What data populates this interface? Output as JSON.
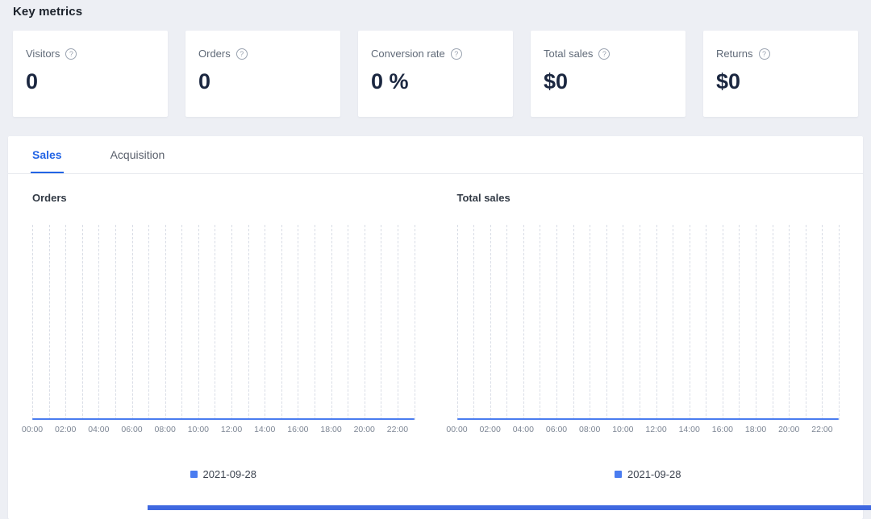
{
  "page": {
    "title": "Key metrics"
  },
  "icons": {
    "help": "?"
  },
  "metrics": [
    {
      "label": "Visitors",
      "value": "0"
    },
    {
      "label": "Orders",
      "value": "0"
    },
    {
      "label": "Conversion rate",
      "value": "0 %"
    },
    {
      "label": "Total sales",
      "value": "$0"
    },
    {
      "label": "Returns",
      "value": "$0"
    }
  ],
  "tabs": [
    {
      "label": "Sales",
      "active": true
    },
    {
      "label": "Acquisition",
      "active": false
    }
  ],
  "chart_data": [
    {
      "type": "line",
      "title": "Orders",
      "x_ticks": [
        "00:00",
        "02:00",
        "04:00",
        "06:00",
        "08:00",
        "10:00",
        "12:00",
        "14:00",
        "16:00",
        "18:00",
        "20:00",
        "22:00"
      ],
      "series": [
        {
          "name": "2021-09-28",
          "color": "#4a7cf0",
          "values": [
            0,
            0,
            0,
            0,
            0,
            0,
            0,
            0,
            0,
            0,
            0,
            0,
            0,
            0,
            0,
            0,
            0,
            0,
            0,
            0,
            0,
            0,
            0,
            0
          ]
        }
      ],
      "ylim": [
        0,
        1
      ],
      "grid": "vertical-dashed",
      "legend_position": "bottom-center"
    },
    {
      "type": "line",
      "title": "Total sales",
      "x_ticks": [
        "00:00",
        "02:00",
        "04:00",
        "06:00",
        "08:00",
        "10:00",
        "12:00",
        "14:00",
        "16:00",
        "18:00",
        "20:00",
        "22:00"
      ],
      "series": [
        {
          "name": "2021-09-28",
          "color": "#4a7cf0",
          "values": [
            0,
            0,
            0,
            0,
            0,
            0,
            0,
            0,
            0,
            0,
            0,
            0,
            0,
            0,
            0,
            0,
            0,
            0,
            0,
            0,
            0,
            0,
            0,
            0
          ]
        }
      ],
      "ylim": [
        0,
        1
      ],
      "grid": "vertical-dashed",
      "legend_position": "bottom-center"
    }
  ],
  "colors": {
    "page_bg": "#edeff4",
    "accent_blue": "#2264e5",
    "line_blue": "#4a7cf0",
    "value_text": "#1b2740",
    "bottom_bar": "#3f68e0"
  }
}
